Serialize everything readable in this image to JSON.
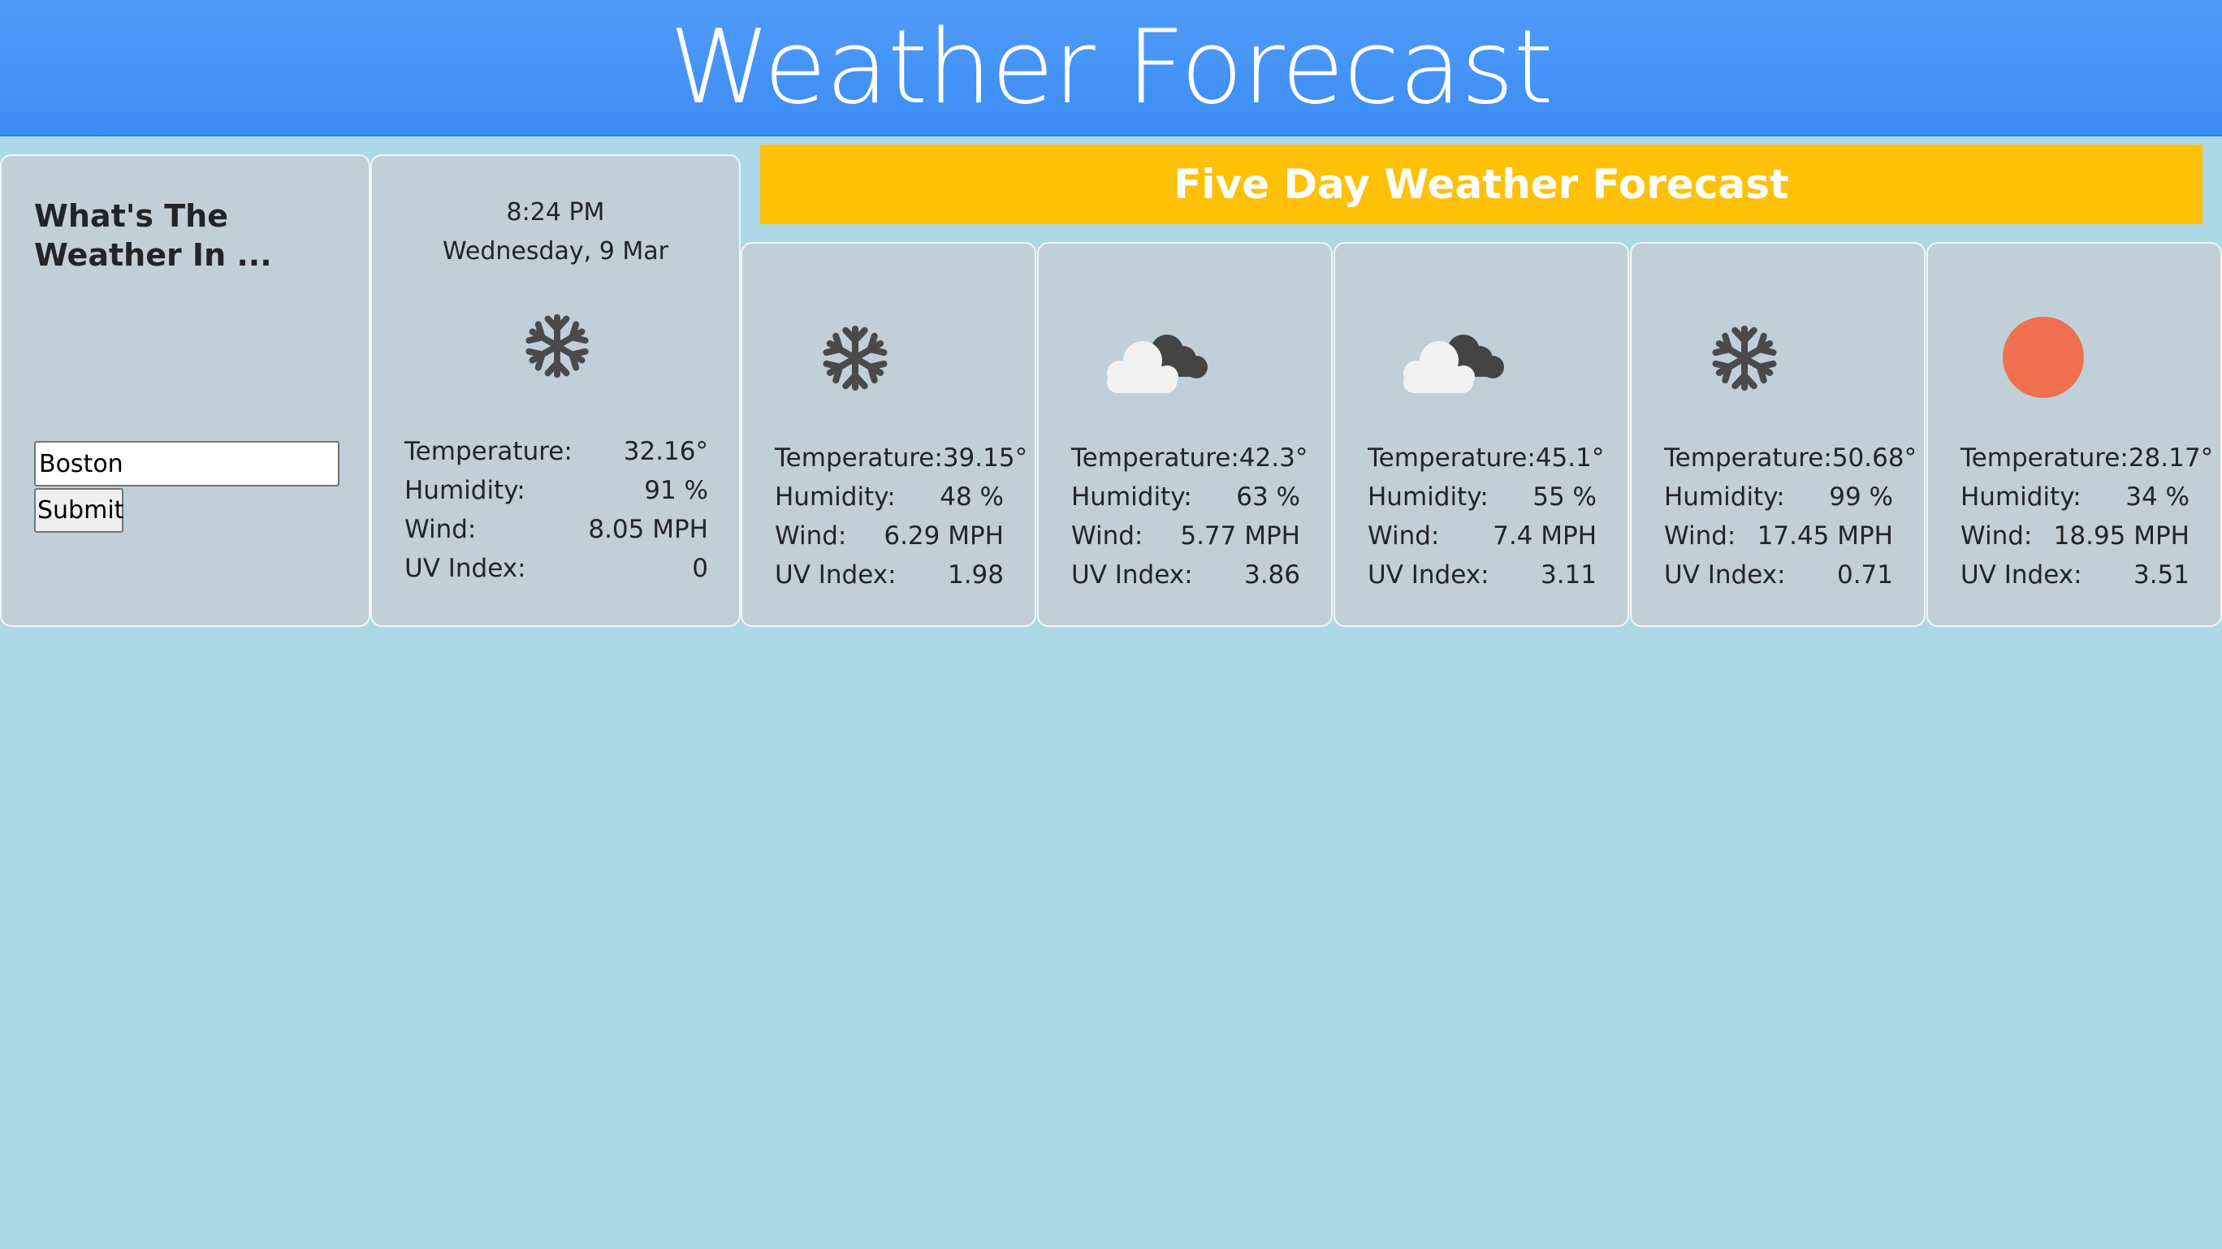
{
  "header": {
    "title": "Weather Forecast"
  },
  "search": {
    "heading": "What's The Weather In ...",
    "input_value": "Boston",
    "submit_label": "Submit"
  },
  "today": {
    "time": "8:24 PM",
    "date": "Wednesday, 9 Mar",
    "icon": "snowflake-icon",
    "temperature_label": "Temperature:",
    "temperature": "32.16°",
    "humidity_label": "Humidity:",
    "humidity": "91 %",
    "wind_label": "Wind:",
    "wind": "8.05 MPH",
    "uv_label": "UV Index:",
    "uv": "0"
  },
  "forecast": {
    "title": "Five Day Weather Forecast",
    "days": [
      {
        "icon": "snowflake-icon",
        "temperature_label": "Temperature:",
        "temperature": "39.15°",
        "humidity_label": "Humidity:",
        "humidity": "48 %",
        "wind_label": "Wind:",
        "wind": "6.29 MPH",
        "uv_label": "UV Index:",
        "uv": "1.98"
      },
      {
        "icon": "cloudy-icon",
        "temperature_label": "Temperature:",
        "temperature": "42.3°",
        "humidity_label": "Humidity:",
        "humidity": "63 %",
        "wind_label": "Wind:",
        "wind": "5.77 MPH",
        "uv_label": "UV Index:",
        "uv": "3.86"
      },
      {
        "icon": "cloudy-icon",
        "temperature_label": "Temperature:",
        "temperature": "45.1°",
        "humidity_label": "Humidity:",
        "humidity": "55 %",
        "wind_label": "Wind:",
        "wind": "7.4 MPH",
        "uv_label": "UV Index:",
        "uv": "3.11"
      },
      {
        "icon": "snowflake-icon",
        "temperature_label": "Temperature:",
        "temperature": "50.68°",
        "humidity_label": "Humidity:",
        "humidity": "99 %",
        "wind_label": "Wind:",
        "wind": "17.45 MPH",
        "uv_label": "UV Index:",
        "uv": "0.71"
      },
      {
        "icon": "sun-icon",
        "temperature_label": "Temperature:",
        "temperature": "28.17°",
        "humidity_label": "Humidity:",
        "humidity": "34 %",
        "wind_label": "Wind:",
        "wind": "18.95 MPH",
        "uv_label": "UV Index:",
        "uv": "3.51"
      }
    ]
  },
  "colors": {
    "header": "#4a95f8",
    "background": "#add8e6",
    "card": "#c1d0d8",
    "banner": "#fec107",
    "sun": "#ef6f4e",
    "icon_dark": "#4a4a4a"
  }
}
